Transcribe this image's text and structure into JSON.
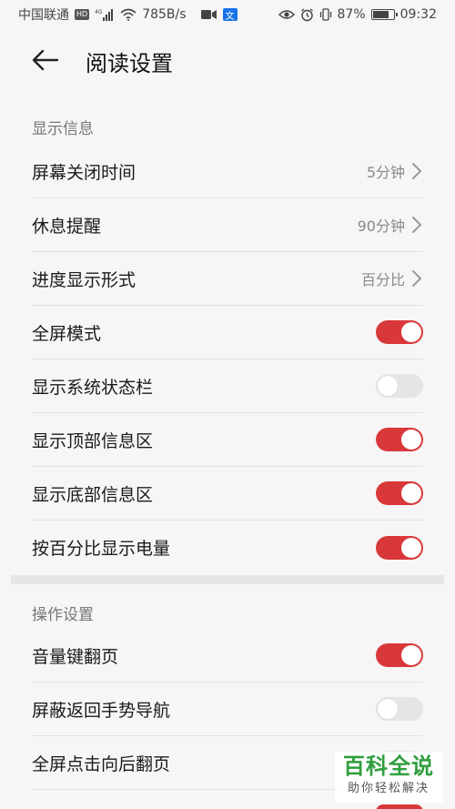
{
  "status_bar": {
    "carrier": "中国联通",
    "hd": "HD",
    "network": "4G",
    "speed": "785B/s",
    "battery_pct": "87%",
    "battery_level": 0.87,
    "time": "09:32",
    "translate_glyph": "文"
  },
  "header": {
    "title": "阅读设置"
  },
  "sections": [
    {
      "title": "显示信息",
      "rows": [
        {
          "label": "屏幕关闭时间",
          "type": "nav",
          "value": "5分钟"
        },
        {
          "label": "休息提醒",
          "type": "nav",
          "value": "90分钟"
        },
        {
          "label": "进度显示形式",
          "type": "nav",
          "value": "百分比"
        },
        {
          "label": "全屏模式",
          "type": "toggle",
          "on": true
        },
        {
          "label": "显示系统状态栏",
          "type": "toggle",
          "on": false
        },
        {
          "label": "显示顶部信息区",
          "type": "toggle",
          "on": true
        },
        {
          "label": "显示底部信息区",
          "type": "toggle",
          "on": true
        },
        {
          "label": "按百分比显示电量",
          "type": "toggle",
          "on": true
        }
      ]
    },
    {
      "title": "操作设置",
      "rows": [
        {
          "label": "音量键翻页",
          "type": "toggle",
          "on": true
        },
        {
          "label": "屏蔽返回手势导航",
          "type": "toggle",
          "on": false
        },
        {
          "label": "全屏点击向后翻页",
          "type": "toggle",
          "on": false
        }
      ]
    }
  ],
  "watermark": {
    "main": "百科全说",
    "sub": "助你轻松解决"
  },
  "colors": {
    "toggle_on": "#d8383a",
    "toggle_off": "#e6e4e5",
    "background": "#f7f5f6",
    "watermark_green": "#2f9e3e"
  }
}
